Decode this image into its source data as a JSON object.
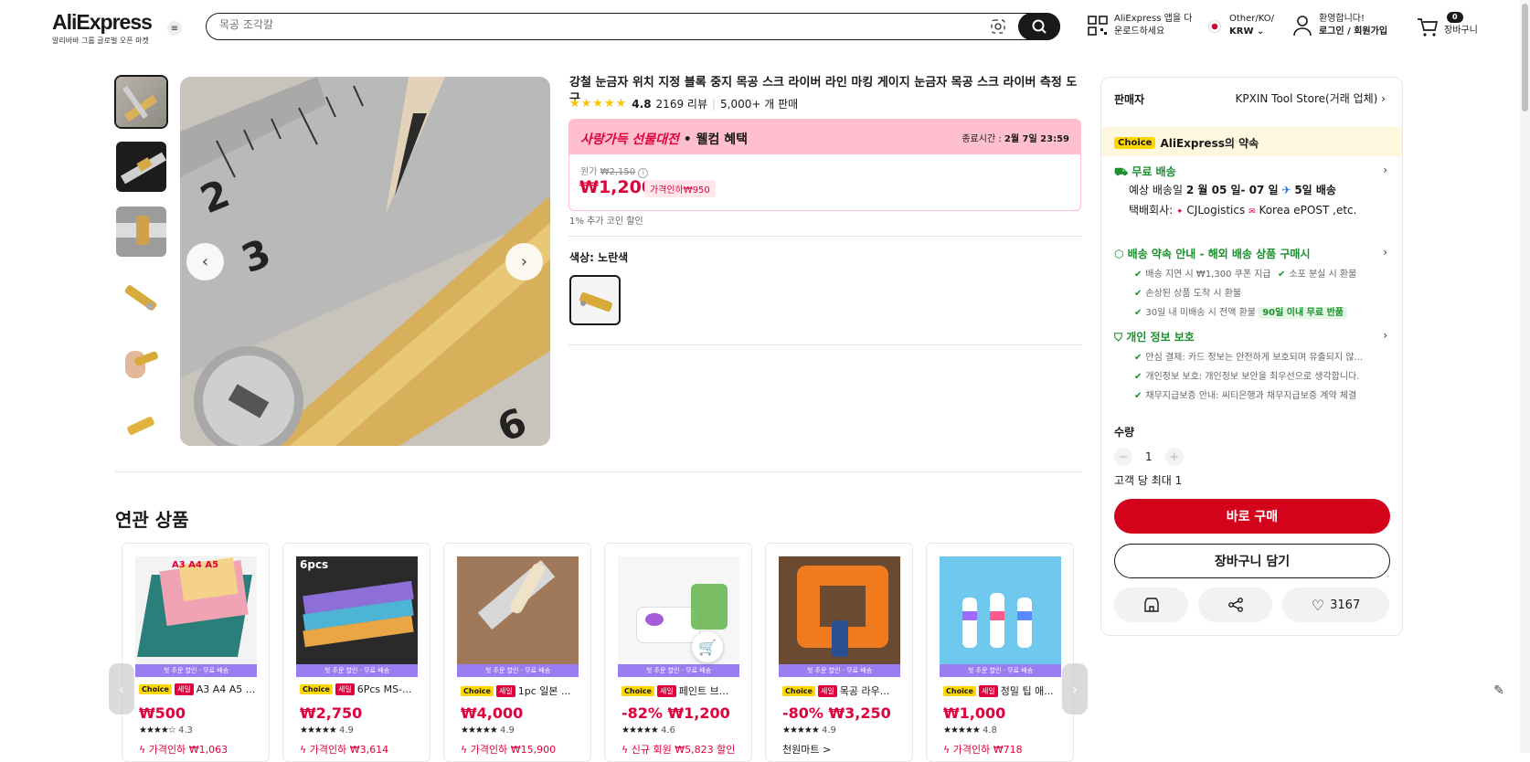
{
  "header": {
    "logo": "AliExpress",
    "logo_sub": "알리바바 그룹 글로벌 오픈 마켓",
    "search_placeholder": "목공 조각칼",
    "app_line1": "AliExpress 앱을 다",
    "app_line2": "운로드하세요",
    "region_line1": "Other/KO/",
    "region_line2": "KRW",
    "account_line1": "환영합니다!",
    "account_line2": "로그인 / 회원가입",
    "cart_count": "0",
    "cart_label": "장바구니"
  },
  "product": {
    "title": "강철 눈금자 위치 지정 블록 중지 목공 스크 라이버 라인 마킹 게이지 눈금자 목공 스크 라이버 측정 도구",
    "rating": "4.8",
    "reviews": "2169 리뷰",
    "sold": "5,000+ 개 판매",
    "promo_title_red": "사랑가득 선물대전",
    "promo_title_rest": " • 웰컴 혜택",
    "promo_end_label": "종료시간 : ",
    "promo_end_value": "2월 7일 23:59",
    "orig_label": "원가",
    "orig_price": "₩2,150",
    "price": "₩1,200",
    "discount_tag": "가격인하₩950",
    "coin_note": "1% 추가 코인 할인",
    "color_label": "색상: 노란색"
  },
  "seller": {
    "label": "판매자",
    "name": "KPXIN Tool Store(거래 업체)",
    "choice_badge": "Choice",
    "promise": "AliExpress의 약속",
    "shipping_title": "무료 배송",
    "delivery_prefix": "예상 배송일 ",
    "delivery_dates": "2 월 05 일- 07 일",
    "delivery_days": "5일 배송",
    "carrier_label": "택배회사: ",
    "carrier_1": "CJLogistics",
    "carrier_2": "Korea",
    "carrier_3": "ePOST ,etc.",
    "promise2_title": "배송 약속 안내 - 해외 배송 상품 구매시",
    "p2_items": [
      "배송 지연 시 ₩1,300 쿠폰 지급",
      "소포 분실 시 환불",
      "손상된 상품 도착 시 환불",
      "30일 내 미배송 시 전액 환불"
    ],
    "p2_tag": "90일 이내 무료 반품",
    "privacy_title": "개인 정보 보호",
    "privacy_items": [
      "안심 결제: 카드 정보는 안전하게 보호되며 유출되지 않...",
      "개인정보 보호: 개인정보 보안을 최우선으로 생각합니다.",
      "채무지급보증 안내: 씨티은행과 채무지급보증 계약 체결"
    ],
    "qty_label": "수량",
    "qty_value": "1",
    "max_label": "고객 당 최대 1",
    "buy_label": "바로 구매",
    "cart_label": "장바구니 담기",
    "wish_count": "3167"
  },
  "related": {
    "title": "연관 상품",
    "strip": "첫 주문 할인 · 무료 배송",
    "items": [
      {
        "choice": "Choice",
        "sale": "세일",
        "name": "A3 A4 A5 ...",
        "price": "₩500",
        "rating": "4.3",
        "bottom": "가격인하 ₩1,063"
      },
      {
        "choice": "Choice",
        "sale": "세일",
        "name": "6Pcs MS-...",
        "price": "₩2,750",
        "rating": "4.9",
        "bottom": "가격인하 ₩3,614"
      },
      {
        "choice": "Choice",
        "sale": "세일",
        "name": "1pc 일본 ...",
        "price": "₩4,000",
        "rating": "4.9",
        "bottom": "가격인하 ₩15,900"
      },
      {
        "choice": "Choice",
        "sale": "세일",
        "name": "페인트 브...",
        "price": "-82% ₩1,200",
        "rating": "4.6",
        "bottom": "신규 회원 ₩5,823 할인"
      },
      {
        "choice": "Choice",
        "sale": "세일",
        "name": "목공 라우...",
        "price": "-80% ₩3,250",
        "rating": "4.9",
        "bottom": "천원마트 >"
      },
      {
        "choice": "Choice",
        "sale": "세일",
        "name": "정밀 팁 애...",
        "price": "₩1,000",
        "rating": "4.8",
        "bottom": "가격인하 ₩718"
      }
    ]
  },
  "colors": {
    "accent": "#e0003c",
    "buy": "#d3031c",
    "choice": "#fdd800",
    "green": "#1a8f2e"
  }
}
